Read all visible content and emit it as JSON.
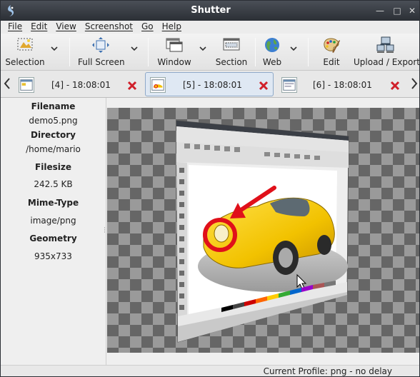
{
  "window": {
    "title": "Shutter"
  },
  "menu": [
    "File",
    "Edit",
    "View",
    "Screenshot",
    "Go",
    "Help"
  ],
  "toolbar": {
    "selection": "Selection",
    "full_screen": "Full Screen",
    "window": "Window",
    "section": "Section",
    "web": "Web",
    "edit": "Edit",
    "upload_export": "Upload / Export"
  },
  "tabs": [
    {
      "label": "[4] - 18:08:01",
      "active": false
    },
    {
      "label": "[5] - 18:08:01",
      "active": true
    },
    {
      "label": "[6] - 18:08:01",
      "active": false
    }
  ],
  "info": {
    "filename_label": "Filename",
    "filename": "demo5.png",
    "directory_label": "Directory",
    "directory": "/home/mario",
    "filesize_label": "Filesize",
    "filesize": "242.5 KB",
    "mimetype_label": "Mime-Type",
    "mimetype": "image/png",
    "geometry_label": "Geometry",
    "geometry": "935x733"
  },
  "status": {
    "profile": "Current Profile: png - no delay"
  },
  "icons": {
    "app": "shutter-icon",
    "minimize": "minimize-icon",
    "maximize": "maximize-icon",
    "close": "close-icon",
    "selection": "selection-icon",
    "full_screen": "fullscreen-icon",
    "window": "window-icon",
    "section": "section-icon",
    "web": "globe-icon",
    "edit": "paint-palette-icon",
    "upload": "computer-network-icon"
  },
  "colors": {
    "accent_close": "#d0202a",
    "car": "#f2c200",
    "highlight_circle": "#e0101a"
  }
}
